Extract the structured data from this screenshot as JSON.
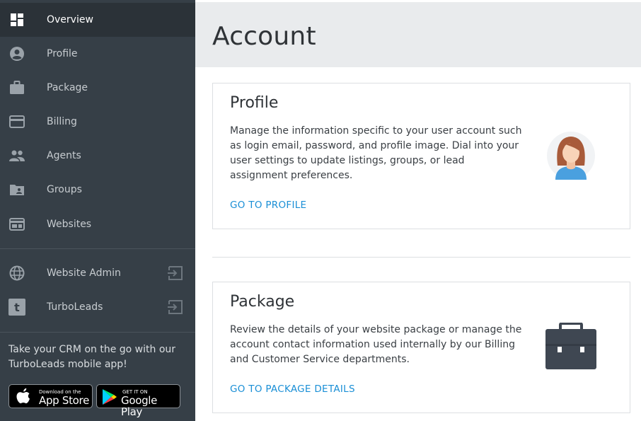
{
  "sidebar": {
    "items": [
      {
        "label": "Overview",
        "icon": "dashboard-icon"
      },
      {
        "label": "Profile",
        "icon": "user-circle-icon"
      },
      {
        "label": "Package",
        "icon": "briefcase-icon"
      },
      {
        "label": "Billing",
        "icon": "credit-card-icon"
      },
      {
        "label": "Agents",
        "icon": "people-icon"
      },
      {
        "label": "Groups",
        "icon": "folder-shared-icon"
      },
      {
        "label": "Websites",
        "icon": "web-window-icon"
      }
    ],
    "external_items": [
      {
        "label": "Website Admin",
        "icon": "globe-icon"
      },
      {
        "label": "TurboLeads",
        "icon": "turboleads-logo-icon",
        "logo_letter": "t"
      }
    ],
    "promo_text": "Take your CRM on the go with our TurboLeads mobile app!",
    "app_store": {
      "small": "Download on the",
      "big": "App Store"
    },
    "google_play": {
      "small": "GET IT ON",
      "big": "Google Play"
    }
  },
  "main": {
    "title": "Account",
    "cards": [
      {
        "title": "Profile",
        "description": "Manage the information specific to your user account such as login email, password, and profile image. Dial into your user settings to update listings, groups, or lead assignment preferences.",
        "link": "GO TO PROFILE",
        "illustration": "woman-avatar-illustration"
      },
      {
        "title": "Package",
        "description": "Review the details of your website package or manage the account contact information used internally by our Billing and Customer Service departments.",
        "link": "GO TO PACKAGE DETAILS",
        "illustration": "briefcase-illustration"
      }
    ]
  },
  "colors": {
    "sidebar_bg": "#363f47",
    "sidebar_active_bg": "#2b3238",
    "link": "#1a8fd6",
    "header_bg": "#e9ebed"
  }
}
